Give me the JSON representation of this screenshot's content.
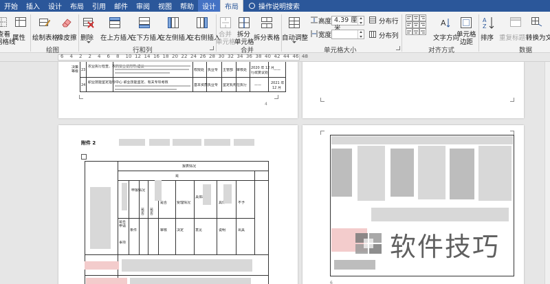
{
  "tabs": [
    {
      "label": "开始",
      "active": false,
      "context": false
    },
    {
      "label": "插入",
      "active": false,
      "context": false
    },
    {
      "label": "设计",
      "active": false,
      "context": false
    },
    {
      "label": "布局",
      "active": false,
      "context": false
    },
    {
      "label": "引用",
      "active": false,
      "context": false
    },
    {
      "label": "邮件",
      "active": false,
      "context": false
    },
    {
      "label": "审阅",
      "active": false,
      "context": false
    },
    {
      "label": "视图",
      "active": false,
      "context": false
    },
    {
      "label": "帮助",
      "active": false,
      "context": false
    },
    {
      "label": "设计",
      "active": false,
      "context": true
    },
    {
      "label": "布局",
      "active": true,
      "context": true
    }
  ],
  "tell_me": "操作说明搜索",
  "ribbon": {
    "table_group": {
      "view_gridlines_line1": "查看",
      "view_gridlines_line2": "网格线",
      "properties": "属性"
    },
    "draw_group": {
      "label": "绘图",
      "draw_table": "绘制表格",
      "eraser": "橡皮擦"
    },
    "rows_cols_group": {
      "label": "行和列",
      "delete": "删除",
      "insert_above": "在上方插入",
      "insert_below": "在下方插入",
      "insert_left": "在左侧插入",
      "insert_right": "在右侧插入"
    },
    "merge_group": {
      "label": "合并",
      "merge_cells_line1": "合并",
      "merge_cells_line2": "单元格",
      "split_cells_line1": "拆分",
      "split_cells_line2": "单元格",
      "split_table": "拆分表格"
    },
    "cell_size_group": {
      "label": "单元格大小",
      "autofit": "自动调整",
      "height_label": "高度:",
      "height_value": "4.39 厘米",
      "width_label": "宽度:",
      "width_value": "",
      "distribute_rows": "分布行",
      "distribute_cols": "分布列"
    },
    "alignment_group": {
      "label": "对齐方式",
      "text_direction": "文字方向",
      "cell_margins_line1": "单元格",
      "cell_margins_line2": "边距"
    },
    "data_group": {
      "label": "数据",
      "sort": "排序",
      "repeat_header": "重复标题行",
      "convert_to_text": "转换为文本"
    }
  },
  "ruler": {
    "numbers": [
      "6",
      "4",
      "2",
      "2",
      "4",
      "6",
      "8",
      "10",
      "12",
      "14",
      "16",
      "18",
      "20",
      "22",
      "24",
      "26",
      "28",
      "30",
      "32",
      "34",
      "36",
      "38",
      "40",
      "42",
      "44",
      "46",
      "48"
    ]
  },
  "page1": {
    "row23_num": "23",
    "row23_col0": "决策\n等级",
    "row23_text": "农业执行检查、农药安全使用等,建议",
    "row23_b": "权限处",
    "row23_c": "执业专",
    "row23_d": "主管部",
    "row23_e": "审核处",
    "row23_date": "2020 年 12 月",
    "row23_date2": "行政复议处",
    "row23_dash": "——",
    "row24_num": "24",
    "row24_text": "职业技能鉴定指导中心 职业技能鉴定、有关专项考核",
    "row24_b": "基本资质",
    "row24_c": "执业专",
    "row24_d": "鉴定机构",
    "row24_e": "在执行",
    "row24_dash": "——",
    "row24_date": "2021 年",
    "row24_date2": "12 月",
    "page_number": "4"
  },
  "page2": {
    "header_title": "附件 2",
    "main_header": "报表情况",
    "sub_header": "是",
    "col_labels": [
      "申报情况",
      "是否申请",
      "是否",
      "是否",
      "是否",
      "受理情况",
      "具体出具",
      "具体",
      "不予",
      "出具"
    ],
    "row_labels": [
      "事项",
      "条件",
      "审核",
      "决定",
      "意见",
      "说明"
    ]
  },
  "page3": {
    "page_number": "6"
  },
  "watermark_text": "软件技巧"
}
